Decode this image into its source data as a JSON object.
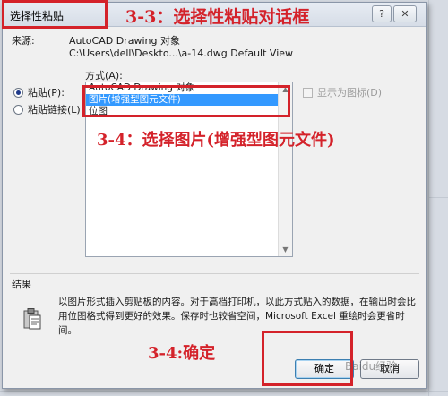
{
  "dialog": {
    "title": "选择性粘贴",
    "help_label": "?",
    "close_label": "✕",
    "source_label": "来源:",
    "source_value": "AutoCAD Drawing 对象",
    "source_path": "C:\\Users\\dell\\Deskto...\\a-14.dwg Default View",
    "method_label": "方式(A):",
    "paste_label": "粘贴(P):",
    "paste_link_label": "粘贴链接(L):",
    "list_items": [
      "AutoCAD Drawing 对象",
      "图片(增强型图元文件)",
      "位图"
    ],
    "selected_index": 1,
    "show_as_icon_label": "显示为图标(D)",
    "result_label": "结果",
    "result_text": "以图片形式插入剪贴板的内容。对于高档打印机，以此方式贴入的数据，在输出时会比用位图格式得到更好的效果。保存时也较省空间，Microsoft Excel 重绘时会更省时间。",
    "ok_label": "确定",
    "cancel_label": "取消"
  },
  "annotations": {
    "step1": "3-3：选择性粘贴对话框",
    "step2": "3-4：选择图片(增强型图元文件)",
    "step3": "3-4:确定"
  },
  "watermark": "Baidu经验",
  "colors": {
    "annotation": "#d4222a",
    "selection": "#3399ff"
  },
  "icons": {
    "result": "clipboard-icon",
    "scroll_up": "scroll-up-arrow-icon",
    "scroll_down": "scroll-down-arrow-icon"
  }
}
